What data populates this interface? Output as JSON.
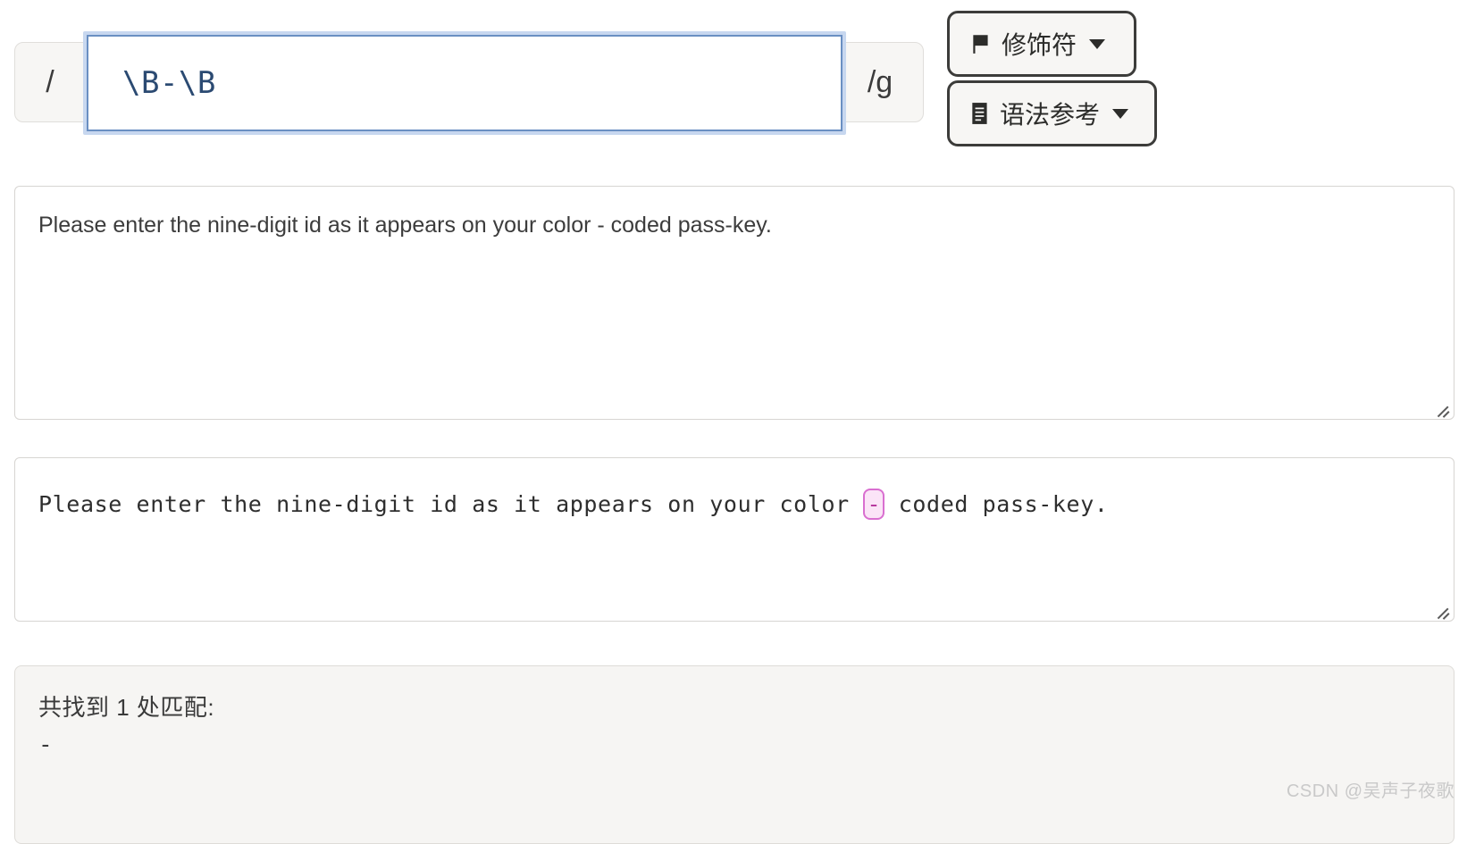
{
  "regex_bar": {
    "left_delimiter": "/",
    "pattern": "\\B-\\B",
    "right_delimiter": "/g",
    "flags": "g"
  },
  "buttons": {
    "modifiers": {
      "label": "修饰符",
      "icon": "flag-icon"
    },
    "syntax_reference": {
      "label": "语法参考",
      "icon": "document-icon"
    }
  },
  "test_input": {
    "value": "Please enter the nine-digit id as it appears on your color - coded pass-key."
  },
  "highlighted_result": {
    "before": "Please enter the nine-digit id as it appears on your color ",
    "match": "-",
    "after": " coded pass-key."
  },
  "matches": {
    "heading": "共找到 1 处匹配:",
    "count": 1,
    "items": [
      "-"
    ]
  },
  "colors": {
    "accent_blue": "#6a8fc2",
    "pattern_text": "#2b4a72",
    "match_highlight_bg": "#fbe4f7",
    "match_highlight_border": "#d96fd0",
    "panel_bg": "#f6f5f3",
    "button_border": "#3c3c3a"
  },
  "watermark": {
    "text": "CSDN @吴声子夜歌"
  }
}
